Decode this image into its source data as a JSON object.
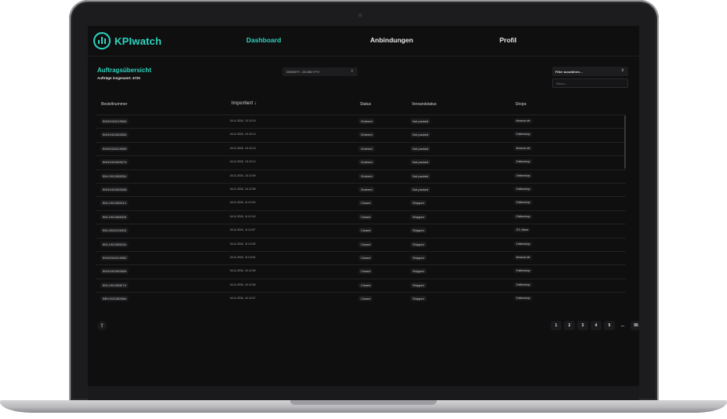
{
  "nav": {
    "brand": "KPIwatch",
    "links": [
      "Dashboard",
      "Anbindungen",
      "Profil"
    ],
    "active": "Dashboard"
  },
  "header": {
    "title": "Auftragsübersicht",
    "subtitle": "Aufträge insgesamt: 4725"
  },
  "date_range": {
    "value": "DD/MM/YY - DD.MM.YYYY"
  },
  "filter": {
    "select_label": "Filter auswählen...",
    "input_placeholder": "Filtern..."
  },
  "table": {
    "columns": [
      "Bestellnummer",
      "Importiert ↓",
      "Status",
      "Versandstatus",
      "Shops"
    ],
    "rows": [
      {
        "order": "BVN2024215304",
        "date": "16.11.2024, 13:12:15",
        "status": "Ordered",
        "shipping": "Not packed",
        "shop": "Amazon.de"
      },
      {
        "order": "BVN1921553304",
        "date": "16.11.2024, 13:12:14",
        "status": "Ordered",
        "shipping": "Not packed",
        "shop": "Onlineshop"
      },
      {
        "order": "BVN2024215305",
        "date": "16.11.2024, 13:12:13",
        "status": "Ordered",
        "shipping": "Not packed",
        "shop": "Amazon.de"
      },
      {
        "order": "BVN1921553274",
        "date": "16.11.2024, 13:12:12",
        "status": "Ordered",
        "shipping": "Not packed",
        "shop": "Onlineshop"
      },
      {
        "order": "BVL1921553354",
        "date": "16.11.2024, 13:12:09",
        "status": "Ordered",
        "shipping": "Not packed",
        "shop": "Onlineshop"
      },
      {
        "order": "BVN1921553346",
        "date": "16.11.2024, 13:12:08",
        "status": "Ordered",
        "shipping": "Not packed",
        "shop": "Onlineshop"
      },
      {
        "order": "BVL1921553314",
        "date": "16.11.2024, 11:12:09",
        "status": "Closed",
        "shipping": "Shipped",
        "shop": "Onlineshop"
      },
      {
        "order": "BVL1921553326",
        "date": "16.11.2024, 11:12:18",
        "status": "Closed",
        "shipping": "Shipped",
        "shop": "Onlineshop"
      },
      {
        "order": "BVL2024215303",
        "date": "16.11.2024, 11:12:57",
        "status": "Closed",
        "shipping": "Shipped",
        "shop": "JTL-Wawi"
      },
      {
        "order": "BVL1921553334",
        "date": "16.11.2024, 11:12:05",
        "status": "Closed",
        "shipping": "Shipped",
        "shop": "Onlineshop"
      },
      {
        "order": "BVN2024215352",
        "date": "16.11.2024, 11:13:04",
        "status": "Closed",
        "shipping": "Shipped",
        "shop": "Amazon.de"
      },
      {
        "order": "BVN1921553304",
        "date": "16.11.2024, 10:12:09",
        "status": "Closed",
        "shipping": "Shipped",
        "shop": "Onlineshop"
      },
      {
        "order": "BVL1921553274",
        "date": "16.11.2024, 10:12:06",
        "status": "Closed",
        "shipping": "Shipped",
        "shop": "Onlineshop"
      },
      {
        "order": "BBV1921552854",
        "date": "16.11.2024, 10:12:07",
        "status": "Closed",
        "shipping": "Shipped",
        "shop": "Onlineshop"
      }
    ]
  },
  "pagination": {
    "pages": [
      "1",
      "2",
      "3",
      "4",
      "5",
      "...",
      "95"
    ]
  },
  "colors": {
    "accent": "#2dd4bf",
    "background": "#0f0f10",
    "pill": "#1c1c1e"
  }
}
